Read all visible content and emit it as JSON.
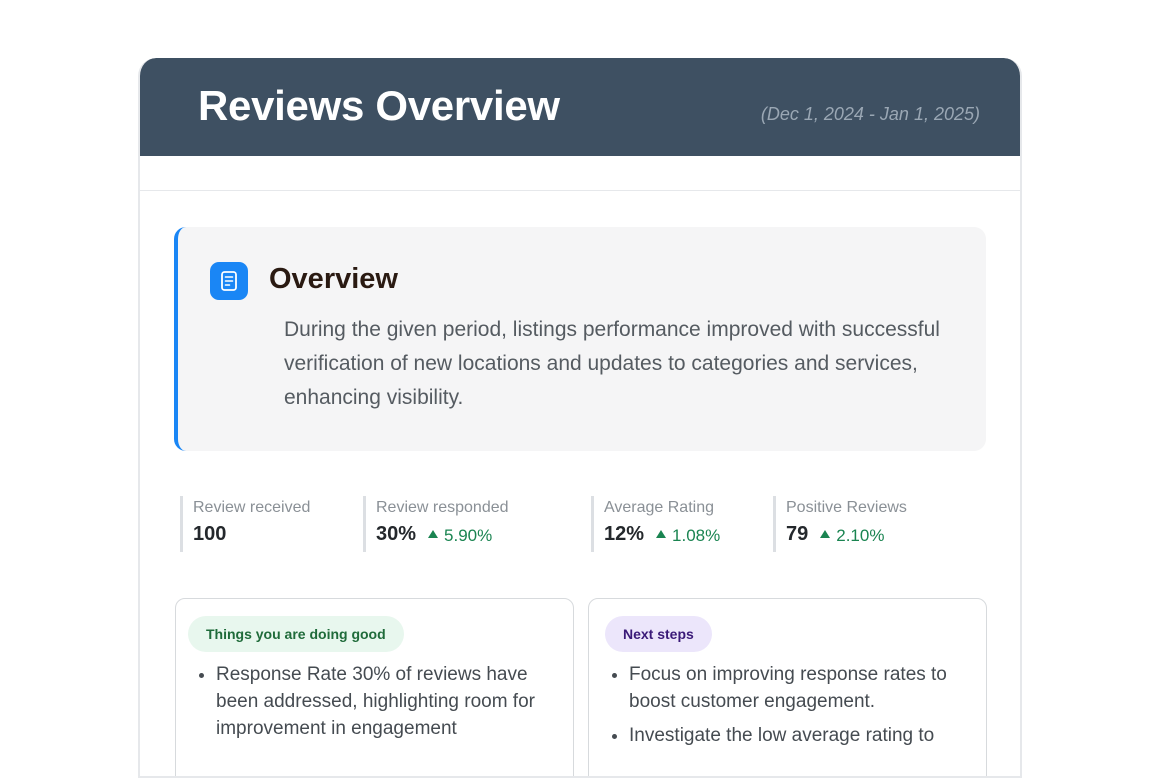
{
  "header": {
    "title": "Reviews Overview",
    "date_range": "(Dec 1, 2024 - Jan 1, 2025)",
    "background_color": "#3e5062"
  },
  "overview": {
    "icon": "document-icon",
    "title": "Overview",
    "text": "During the given period, listings performance improved with successful verification of new locations and updates to categories and services, enhancing visibility.",
    "accent_color": "#1a86f5"
  },
  "stats": [
    {
      "label": "Review received",
      "value": "100",
      "delta": ""
    },
    {
      "label": "Review responded",
      "value": "30%",
      "delta": "5.90%"
    },
    {
      "label": "Average Rating",
      "value": "12%",
      "delta": "1.08%"
    },
    {
      "label": "Positive Reviews",
      "value": "79",
      "delta": "2.10%"
    }
  ],
  "panels": {
    "good": {
      "pill": "Things you are doing good",
      "items": [
        "Response Rate 30% of reviews have been addressed, highlighting room for improvement in engagement"
      ]
    },
    "next": {
      "pill": "Next steps",
      "items": [
        "Focus on improving response rates to boost customer engagement.",
        "Investigate the low average rating to"
      ]
    }
  },
  "colors": {
    "positive": "#1a8451",
    "good_pill_bg": "#e8f7ee",
    "next_pill_bg": "#ece6fb"
  }
}
